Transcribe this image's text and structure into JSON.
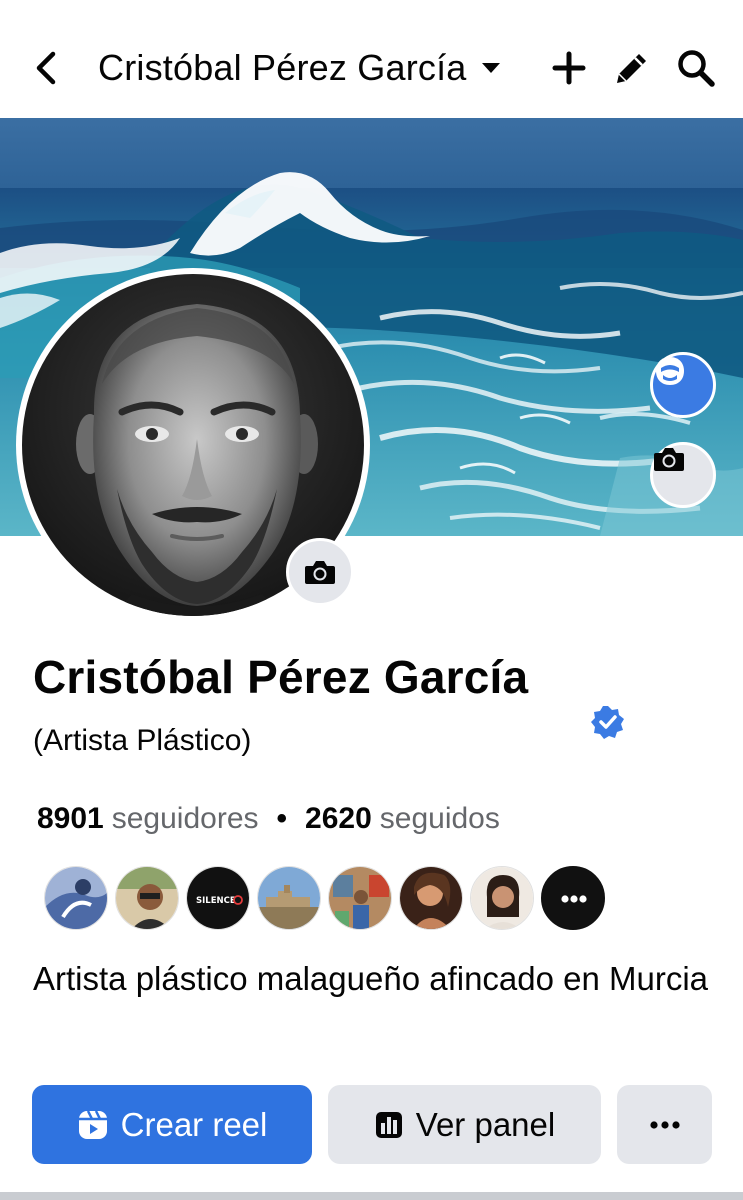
{
  "header": {
    "title": "Cristóbal Pérez García",
    "icons": {
      "back": "chevron-left-icon",
      "dropdown": "caret-down-icon",
      "add": "plus-icon",
      "edit": "pencil-icon",
      "search": "search-icon"
    }
  },
  "cover": {
    "avatar_button_icon": "avatar-icon",
    "camera_icon": "camera-icon"
  },
  "profile": {
    "name": "Cristóbal Pérez García",
    "subtitle": "(Artista Plástico)",
    "verified_icon": "verified-badge-icon",
    "followers_count": "8901",
    "followers_label": "seguidores",
    "separator": "•",
    "following_count": "2620",
    "following_label": "seguidos",
    "bio": "Artista plástico malagueño afincado en Murcia"
  },
  "follower_avatars": {
    "brand_text": "SILENCE",
    "more_icon": "more-horizontal-icon"
  },
  "actions": {
    "create_reel_label": "Crear reel",
    "create_reel_icon": "reel-icon",
    "dashboard_label": "Ver panel",
    "dashboard_icon": "bar-chart-icon",
    "more_icon": "more-horizontal-icon"
  },
  "colors": {
    "accent": "#2f73e0",
    "verified": "#3b7be3",
    "secondary_button": "#e4e6eb",
    "muted_text": "#65676b"
  }
}
